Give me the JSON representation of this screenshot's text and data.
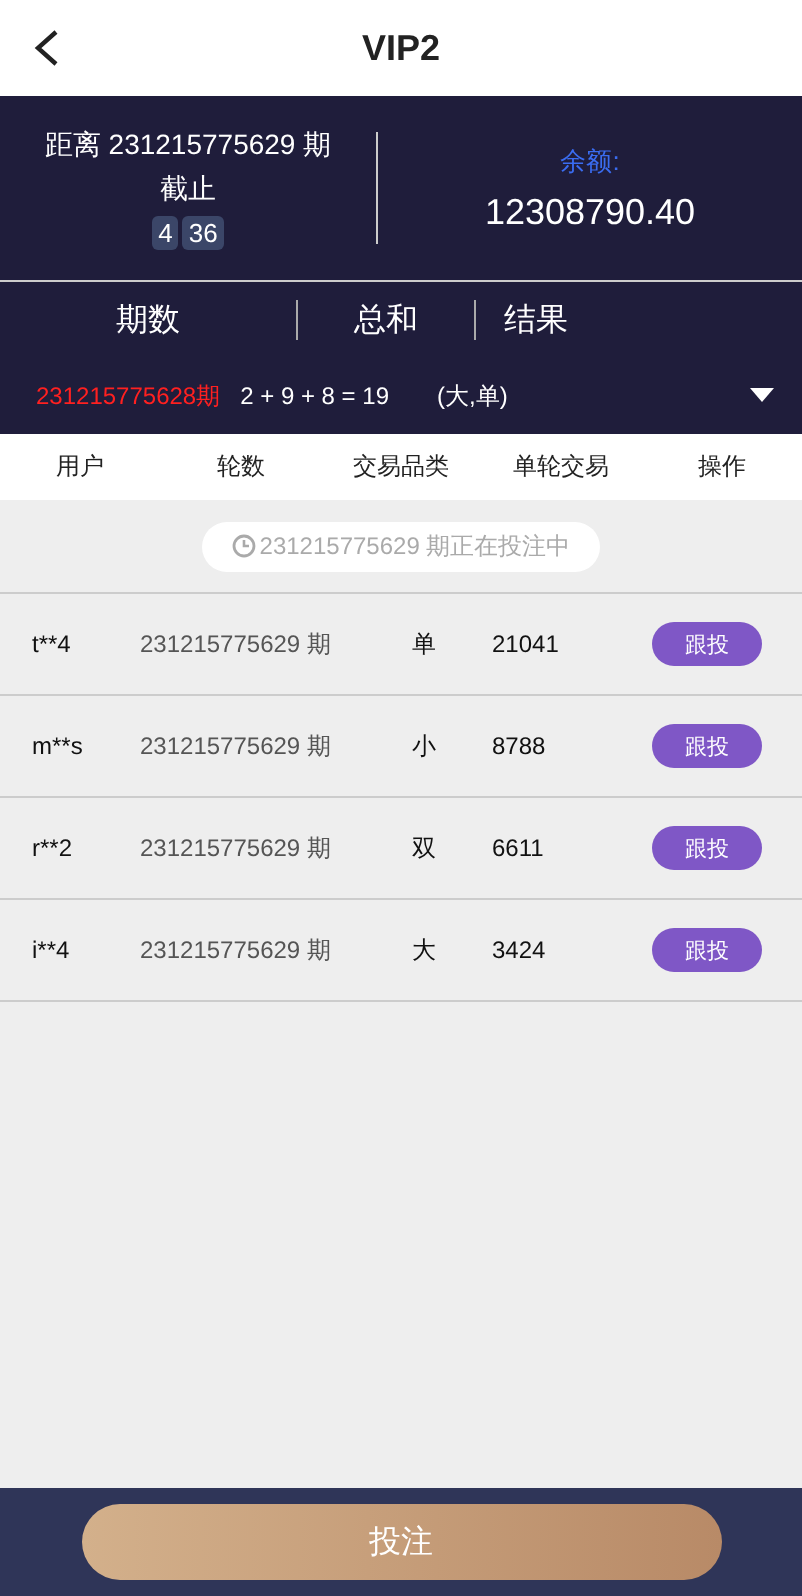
{
  "header": {
    "title": "VIP2"
  },
  "countdown": {
    "prefix": "距离 231215775629 期",
    "suffix": "截止",
    "digits": [
      "4",
      "36"
    ]
  },
  "balance": {
    "label": "余额:",
    "amount": "12308790.40"
  },
  "result_headers": [
    "期数",
    "总和",
    "结果"
  ],
  "latest": {
    "period": "231215775628期",
    "sum": "2 + 9 + 8 = 19",
    "result": "(大,单)"
  },
  "columns": [
    "用户",
    "轮数",
    "交易品类",
    "单轮交易",
    "操作"
  ],
  "status": "231215775629 期正在投注中",
  "rows": [
    {
      "user": "t**4",
      "round": "231215775629 期",
      "category": "单",
      "amount": "21041",
      "action": "跟投"
    },
    {
      "user": "m**s",
      "round": "231215775629 期",
      "category": "小",
      "amount": "8788",
      "action": "跟投"
    },
    {
      "user": "r**2",
      "round": "231215775629 期",
      "category": "双",
      "amount": "6611",
      "action": "跟投"
    },
    {
      "user": "i**4",
      "round": "231215775629 期",
      "category": "大",
      "amount": "3424",
      "action": "跟投"
    }
  ],
  "submit": "投注"
}
